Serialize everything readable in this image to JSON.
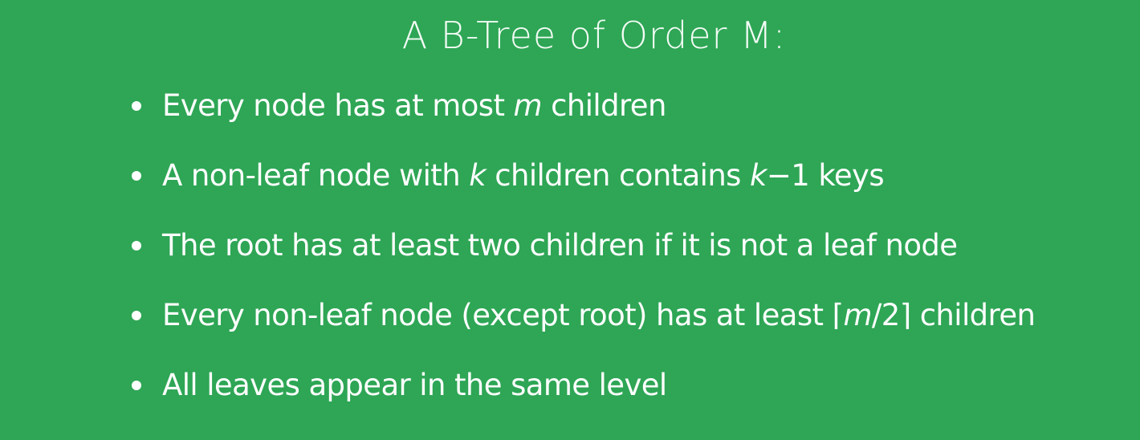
{
  "slide": {
    "title": "A B-Tree of Order M:",
    "bullets": [
      {
        "pre": "Every node has at most ",
        "em": "m",
        "post": " children",
        "em2": "",
        "post2": ""
      },
      {
        "pre": "A non-leaf node with ",
        "em": "k",
        "post": " children contains ",
        "em2": "k",
        "post2": "−1 keys"
      },
      {
        "pre": "The root has at least two children if it is not a leaf node",
        "em": "",
        "post": "",
        "em2": "",
        "post2": ""
      },
      {
        "pre": "Every non-leaf node (except root) has at least ⌈",
        "em": "m",
        "post": "/2⌉ children",
        "em2": "",
        "post2": ""
      },
      {
        "pre": "All leaves appear in the same level",
        "em": "",
        "post": "",
        "em2": "",
        "post2": ""
      }
    ]
  },
  "colors": {
    "background": "#2ea655",
    "text": "#ffffff"
  }
}
